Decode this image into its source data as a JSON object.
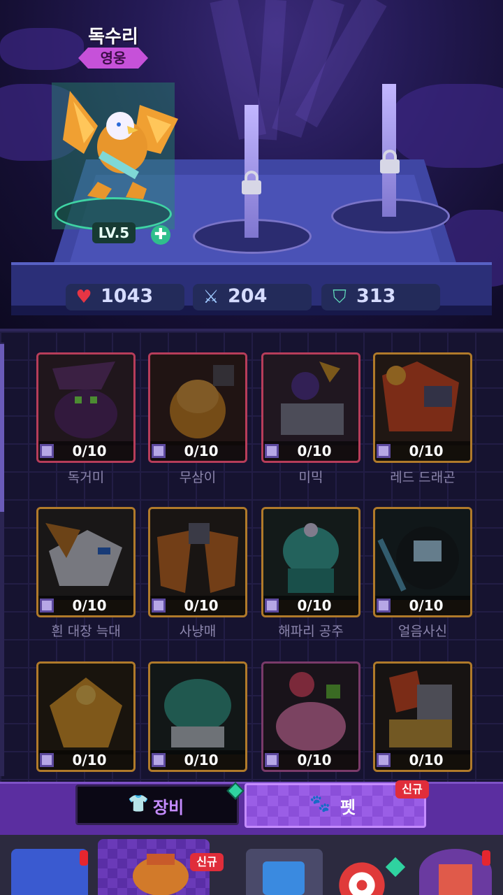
{
  "selected_pet": {
    "name": "독수리",
    "rarity": "영웅",
    "level": "LV.5"
  },
  "stats": {
    "hp": "1043",
    "attack": "204",
    "defense": "313"
  },
  "pets": [
    {
      "name": "독거미",
      "count": "0/10"
    },
    {
      "name": "무삼이",
      "count": "0/10"
    },
    {
      "name": "미믹",
      "count": "0/10"
    },
    {
      "name": "레드 드래곤",
      "count": "0/10"
    },
    {
      "name": "흰 대장 늑대",
      "count": "0/10"
    },
    {
      "name": "사냥매",
      "count": "0/10"
    },
    {
      "name": "해파리 공주",
      "count": "0/10"
    },
    {
      "name": "얼음사신",
      "count": "0/10"
    },
    {
      "name": "",
      "count": "0/10"
    },
    {
      "name": "",
      "count": "0/10"
    },
    {
      "name": "",
      "count": "0/10"
    },
    {
      "name": "",
      "count": "0/10"
    }
  ],
  "tabs": {
    "equipment": "장비",
    "pet": "펫",
    "new_badge": "신규"
  },
  "bottom_nav": {
    "new_badge": "신규"
  },
  "colors": {
    "rarity_hero": "#c651d9",
    "accent_purple": "#8b4fd9",
    "new_red": "#e02d3a",
    "upgrade_green": "#2fbf8c"
  },
  "icons": {
    "hp": "heart-icon",
    "attack": "sword-icon",
    "defense": "shield-icon",
    "equip_tab": "shirt-icon",
    "pet_tab": "paw-icon",
    "locked_slot": "lock-icon",
    "shard": "shard-icon"
  }
}
